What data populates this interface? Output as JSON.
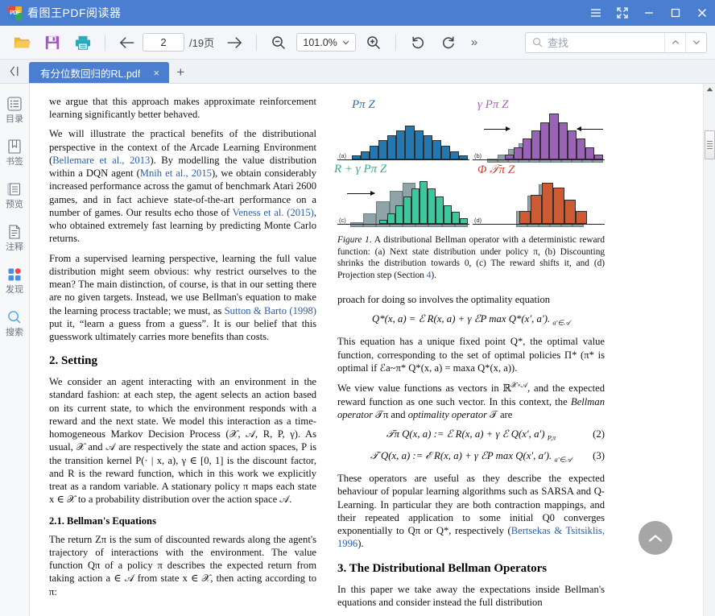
{
  "window": {
    "title": "看图王PDF阅读器",
    "logo_text": "PDF",
    "controls": {
      "menu": "菜单",
      "fullscreen": "全屏",
      "minimize": "最小化",
      "maximize": "最大化",
      "close": "关闭"
    }
  },
  "toolbar": {
    "open_label": "打开",
    "save_label": "保存",
    "print_label": "打印",
    "prev_page_label": "上一页",
    "next_page_label": "下一页",
    "page_value": "2",
    "page_total": "/19页",
    "zoom_out_label": "缩小",
    "zoom_in_label": "放大",
    "zoom_value": "101.0%",
    "rotate_left_label": "左旋转",
    "rotate_right_label": "右旋转",
    "more_label": "»",
    "search_placeholder": "查找",
    "search_value": "",
    "search_prev_label": "上一个",
    "search_next_label": "下一个"
  },
  "tabbar": {
    "collapse_label": "收起",
    "tabs": [
      {
        "label": "有分位数回归的RL.pdf",
        "close_label": "×",
        "active": true
      }
    ],
    "new_tab_label": "+"
  },
  "sidebar": {
    "items": [
      {
        "label": "目录",
        "icon": "list-icon"
      },
      {
        "label": "书签",
        "icon": "bookmark-icon"
      },
      {
        "label": "预览",
        "icon": "preview-icon"
      },
      {
        "label": "注释",
        "icon": "annotation-icon"
      },
      {
        "label": "发现",
        "icon": "discover-icon"
      },
      {
        "label": "搜索",
        "icon": "search-icon"
      }
    ]
  },
  "document": {
    "left_column": {
      "p1": "we argue that this approach makes approximate reinforcement learning significantly better behaved.",
      "p2_a": "We will illustrate the practical benefits of the distributional perspective in the context of the Arcade Learning Environment (",
      "p2_cite1": "Bellemare et al., 2013",
      "p2_b": "). By modelling the value distribution within a DQN agent (",
      "p2_cite2": "Mnih et al., 2015",
      "p2_c": "), we obtain considerably increased performance across the gamut of benchmark Atari 2600 games, and in fact achieve state-of-the-art performance on a number of games. Our results echo those of ",
      "p2_cite3": "Veness et al. (2015)",
      "p2_d": ", who obtained extremely fast learning by predicting Monte Carlo returns.",
      "p3_a": "From a supervised learning perspective, learning the full value distribution might seem obvious: why restrict ourselves to the mean? The main distinction, of course, is that in our setting there are no given targets. Instead, we use Bellman's equation to make the learning process tractable; we must, as ",
      "p3_cite": "Sutton & Barto (1998)",
      "p3_b": " put it, “learn a guess from a guess”. It is our belief that this guesswork ultimately carries more benefits than costs.",
      "h_setting": "2. Setting",
      "p4": "We consider an agent interacting with an environment in the standard fashion: at each step, the agent selects an action based on its current state, to which the environment responds with a reward and the next state. We model this interaction as a time-homogeneous Markov Decision Process (𝒳, 𝒜, R, P, γ). As usual, 𝒳 and 𝒜 are respectively the state and action spaces, P is the transition kernel P(· | x, a), γ ∈ [0, 1] is the discount factor, and R is the reward function, which in this work we explicitly treat as a random variable. A stationary policy π maps each state x ∈ 𝒳 to a probability distribution over the action space 𝒜.",
      "h_bellman": "2.1. Bellman's Equations",
      "p5": "The return Zπ is the sum of discounted rewards along the agent's trajectory of interactions with the environment. The value function Qπ of a policy π describes the expected return from taking action a ∈ 𝒜 from state x ∈ 𝒳, then acting according to π:"
    },
    "right_column": {
      "figure_caption_a": "Figure 1",
      "figure_caption_b": ". A distributional Bellman operator with a deterministic reward function: (a) Next state distribution under policy π, (b) Discounting shrinks the distribution towards 0, (c) The reward shifts it, and (d) Projection step (Section ",
      "figure_caption_link": "4",
      "figure_caption_c": ").",
      "p1": "proach for doing so involves the optimality equation",
      "eq1": "Q*(x, a) = ℰ R(x, a) + γ ℰP max Q*(x′, a′).",
      "eq1_sub": "a′∈𝒜",
      "p2": "This equation has a unique fixed point Q*, the optimal value function, corresponding to the set of optimal policies Π* (π* is optimal if ℰa~π* Q*(x, a) = maxa Q*(x, a)).",
      "p3_a": "We view value functions as vectors in ℝ",
      "p3_sup": "𝒳×𝒜",
      "p3_b": ", and the expected reward function as one such vector. In this context, the ",
      "p3_em1": "Bellman operator",
      "p3_c": " 𝒯π and ",
      "p3_em2": "optimality operator",
      "p3_d": " 𝒯 are",
      "eq2": "𝒯π Q(x, a) := ℰ R(x, a) + γ ℰ Q(x′, a′)",
      "eq2_sub": "P,π",
      "eq2_num": "(2)",
      "eq3": "𝒯 Q(x, a) := ℰ R(x, a) + γ ℰP max Q(x′, a′).",
      "eq3_sub": "a′∈𝒜",
      "eq3_num": "(3)",
      "p4_a": "These operators are useful as they describe the expected behaviour of popular learning algorithms such as SARSA and Q-Learning. In particular they are both contraction mappings, and their repeated application to some initial Q0 converges exponentially to Qπ or Q*, respectively (",
      "p4_cite": "Bertsekas & Tsitsiklis, 1996",
      "p4_b": ").",
      "h_section3": "3. The Distributional Bellman Operators",
      "p5": "In this paper we take away the expectations inside Bellman's equations and consider instead the full distribution"
    }
  },
  "figure": {
    "panels": [
      {
        "tag": "(a)",
        "title": "Pπ Z",
        "title_color": "#2f6fb5",
        "bar_color": "#2577b0",
        "heights": [
          8,
          18,
          30,
          42,
          52,
          62,
          72,
          62,
          52,
          42,
          30,
          18,
          8
        ],
        "ghost_heights": [],
        "arrows": []
      },
      {
        "tag": "(b)",
        "title": "γ Pπ Z",
        "title_color": "#b05ec0",
        "bar_color": "#9a63b8",
        "heights": [
          10,
          26,
          45,
          62,
          80,
          98,
          80,
          62,
          45,
          26,
          10
        ],
        "ghost_heights": [
          8,
          18,
          30,
          42,
          52,
          62,
          52,
          42,
          30,
          18,
          8
        ],
        "ghost_color": "#8fa3a8",
        "arrows": [
          "right",
          "left"
        ]
      },
      {
        "tag": "(c)",
        "title": "R + γ Pπ Z",
        "title_color": "#2fb08a",
        "bar_color": "#3ec79a",
        "heights": [
          8,
          22,
          40,
          58,
          76,
          92,
          76,
          58,
          40,
          26,
          12
        ],
        "ghost_heights": [
          10,
          30,
          55,
          78,
          95,
          72,
          50,
          30,
          14
        ],
        "ghost_color": "#8fa3a8",
        "arrows": [
          "right"
        ]
      },
      {
        "tag": "(d)",
        "title": "Φ 𝒯π Z",
        "title_color": "#d0413a",
        "bar_color": "#cc5a33",
        "heights": [
          28,
          62,
          88,
          78,
          52,
          28
        ],
        "ghost_heights": [
          34,
          68,
          92,
          84,
          58,
          32
        ],
        "ghost_color": "#8fa3a8",
        "arrows": []
      }
    ]
  },
  "scrollbar": {
    "up_label": "向上滚动",
    "thumb_label": "滚动条滑块"
  },
  "scroll_top_button": {
    "label": "回到顶部"
  },
  "colors": {
    "accent": "#4a7ed0",
    "toolbar_bg": "#f4f6f9",
    "link": "#2a5db0"
  }
}
